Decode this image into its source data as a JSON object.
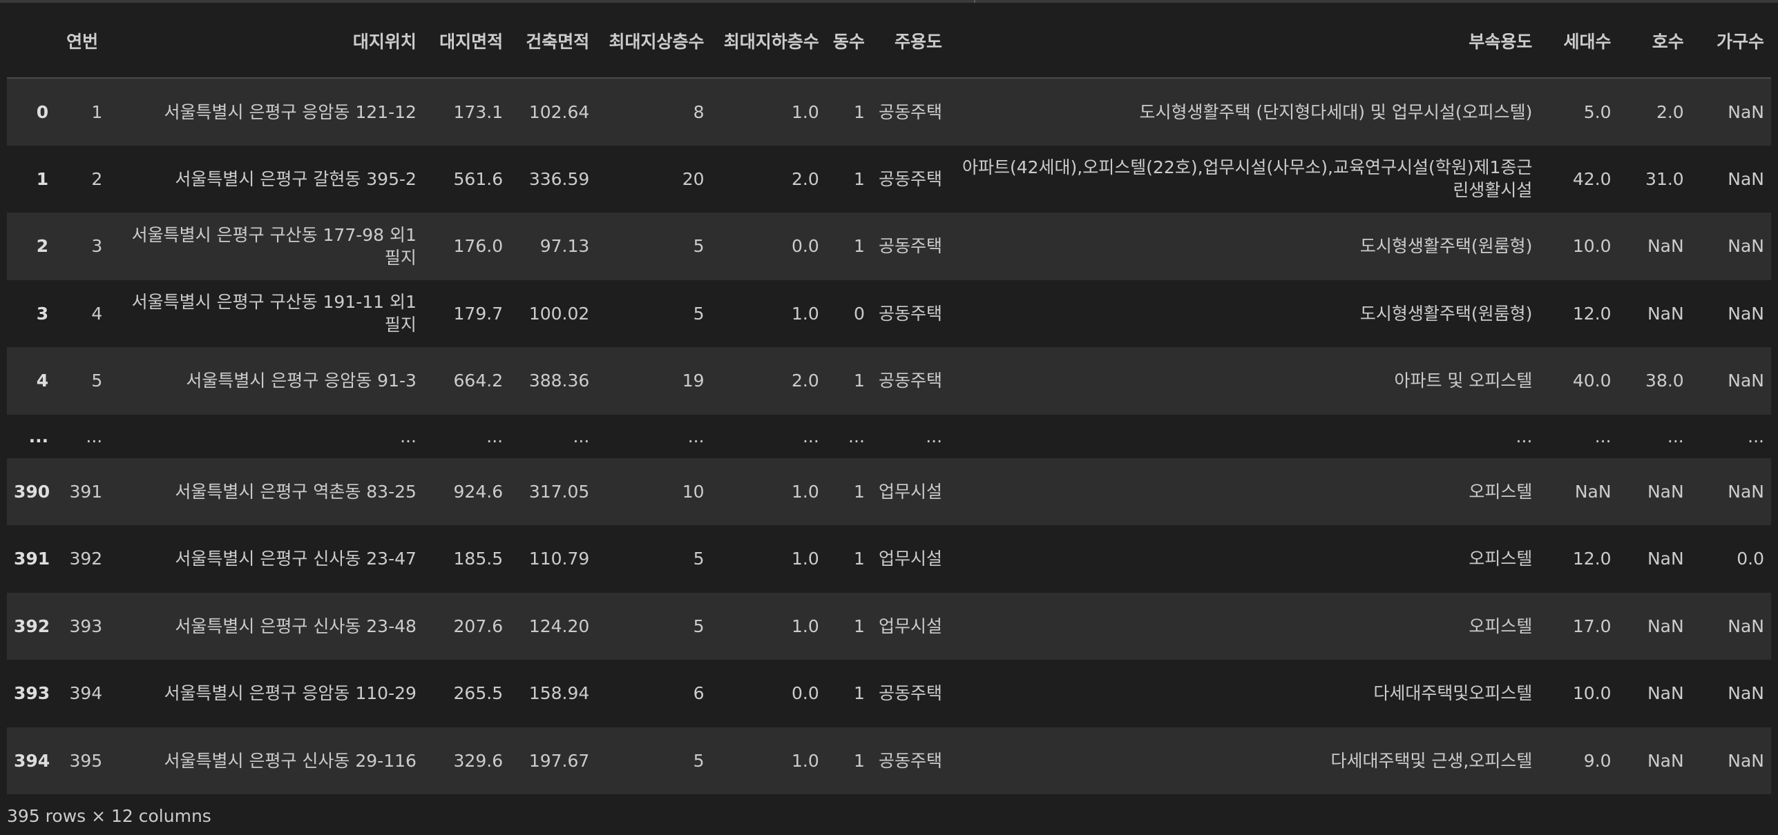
{
  "dataframe": {
    "columns": [
      "연번",
      "대지위치",
      "대지면적",
      "건축면적",
      "최대지상층수",
      "최대지하층수",
      "동수",
      "주용도",
      "부속용도",
      "세대수",
      "호수",
      "가구수"
    ],
    "rows": [
      {
        "index": "0",
        "cells": [
          "1",
          "서울특별시 은평구 응암동 121-12",
          "173.1",
          "102.64",
          "8",
          "1.0",
          "1",
          "공동주택",
          "도시형생활주택 (단지형다세대) 및 업무시설(오피스텔)",
          "5.0",
          "2.0",
          "NaN"
        ]
      },
      {
        "index": "1",
        "cells": [
          "2",
          "서울특별시 은평구 갈현동 395-2",
          "561.6",
          "336.59",
          "20",
          "2.0",
          "1",
          "공동주택",
          "아파트(42세대),오피스텔(22호),업무시설(사무소),교육연구시설(학원)제1종근린생활시설",
          "42.0",
          "31.0",
          "NaN"
        ]
      },
      {
        "index": "2",
        "cells": [
          "3",
          "서울특별시 은평구 구산동 177-98 외1필지",
          "176.0",
          "97.13",
          "5",
          "0.0",
          "1",
          "공동주택",
          "도시형생활주택(원룸형)",
          "10.0",
          "NaN",
          "NaN"
        ]
      },
      {
        "index": "3",
        "cells": [
          "4",
          "서울특별시 은평구 구산동 191-11 외1필지",
          "179.7",
          "100.02",
          "5",
          "1.0",
          "0",
          "공동주택",
          "도시형생활주택(원룸형)",
          "12.0",
          "NaN",
          "NaN"
        ]
      },
      {
        "index": "4",
        "cells": [
          "5",
          "서울특별시 은평구 응암동 91-3",
          "664.2",
          "388.36",
          "19",
          "2.0",
          "1",
          "공동주택",
          "아파트 및 오피스텔",
          "40.0",
          "38.0",
          "NaN"
        ]
      },
      {
        "index": "...",
        "cells": [
          "...",
          "...",
          "...",
          "...",
          "...",
          "...",
          "...",
          "...",
          "...",
          "...",
          "...",
          "..."
        ],
        "ellipsis": true
      },
      {
        "index": "390",
        "cells": [
          "391",
          "서울특별시 은평구 역촌동 83-25",
          "924.6",
          "317.05",
          "10",
          "1.0",
          "1",
          "업무시설",
          "오피스텔",
          "NaN",
          "NaN",
          "NaN"
        ]
      },
      {
        "index": "391",
        "cells": [
          "392",
          "서울특별시 은평구 신사동 23-47",
          "185.5",
          "110.79",
          "5",
          "1.0",
          "1",
          "업무시설",
          "오피스텔",
          "12.0",
          "NaN",
          "0.0"
        ]
      },
      {
        "index": "392",
        "cells": [
          "393",
          "서울특별시 은평구 신사동 23-48",
          "207.6",
          "124.20",
          "5",
          "1.0",
          "1",
          "업무시설",
          "오피스텔",
          "17.0",
          "NaN",
          "NaN"
        ]
      },
      {
        "index": "393",
        "cells": [
          "394",
          "서울특별시 은평구 응암동 110-29",
          "265.5",
          "158.94",
          "6",
          "0.0",
          "1",
          "공동주택",
          "다세대주택및오피스텔",
          "10.0",
          "NaN",
          "NaN"
        ]
      },
      {
        "index": "394",
        "cells": [
          "395",
          "서울특별시 은평구 신사동 29-116",
          "329.6",
          "197.67",
          "5",
          "1.0",
          "1",
          "공동주택",
          "다세대주택및 근생,오피스텔",
          "9.0",
          "NaN",
          "NaN"
        ]
      }
    ],
    "shape_caption": "395 rows × 12 columns"
  },
  "colors": {
    "background": "#1e1e1e",
    "row_stripe": "#2e2e2e",
    "text": "#cccccc"
  }
}
